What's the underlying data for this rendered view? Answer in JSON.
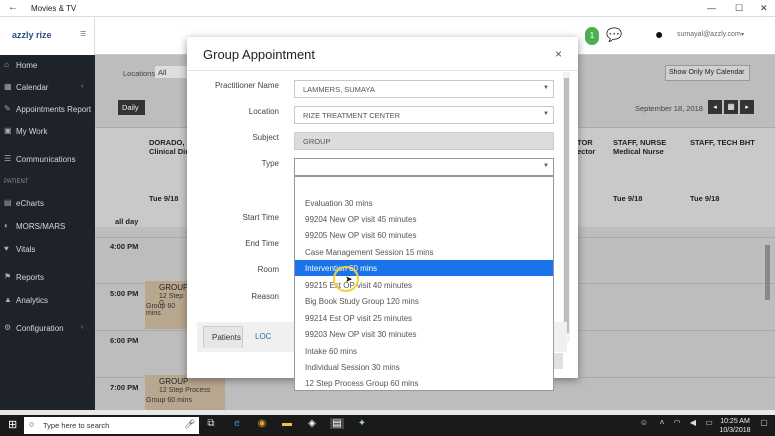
{
  "window": {
    "title": "Movies & TV",
    "minimize": "—",
    "maximize": "☐",
    "close": "✕"
  },
  "app": {
    "logo": "azzly rize",
    "notification_count": "1",
    "user_email": "sumayal@azzly.com"
  },
  "sidebar": {
    "section_patient": "PATIENT",
    "items": [
      {
        "label": "Home",
        "icon": "⌂"
      },
      {
        "label": "Calendar",
        "icon": "▦"
      },
      {
        "label": "Appointments Report",
        "icon": "✎"
      },
      {
        "label": "My Work",
        "icon": "▣"
      },
      {
        "label": "Communications",
        "icon": "☰"
      },
      {
        "label": "eCharts",
        "icon": "▤"
      },
      {
        "label": "MORS/MARS",
        "icon": "◐"
      },
      {
        "label": "Vitals",
        "icon": "♥"
      },
      {
        "label": "Reports",
        "icon": "⚑"
      },
      {
        "label": "Analytics",
        "icon": "▲"
      },
      {
        "label": "Configuration",
        "icon": "⚙"
      }
    ]
  },
  "calendar": {
    "locations_label": "Locations:",
    "locations_value": "All",
    "show_only_button": "Show Only My Calendar",
    "view_daily": "Daily",
    "date": "September 18, 2018",
    "col1_header": "DORADO, I Clinical Dir",
    "col_tor": "TOR ector",
    "col_staff_nurse": "STAFF, NURSE Medical Nurse",
    "col_staff_tech": "STAFF, TECH BHT",
    "day_label": "Tue 9/18",
    "all_day": "all day",
    "times": [
      "4:00 PM",
      "5:00 PM",
      "6:00 PM",
      "7:00 PM"
    ],
    "event1": {
      "title": "GROUP",
      "line1": "12 Step G",
      "line2": "Group 60 mins"
    },
    "event2": {
      "title": "GROUP",
      "line1": "12 Step Process",
      "line2": "Group 60 mins"
    }
  },
  "modal": {
    "title": "Group Appointment",
    "close": "×",
    "fields": {
      "practitioner_label": "Practitioner Name",
      "practitioner_value": "LAMMERS, SUMAYA",
      "location_label": "Location",
      "location_value": "RIZE TREATMENT CENTER",
      "subject_label": "Subject",
      "subject_value": "GROUP",
      "type_label": "Type",
      "type_value": "",
      "start_label": "Start Time",
      "end_label": "End Time",
      "room_label": "Room",
      "reason_label": "Reason"
    },
    "tabs": {
      "patients": "Patients",
      "loc": "LOC"
    }
  },
  "dropdown": {
    "options": [
      "Evaluation 30 mins",
      "99204 New OP visit 45 minutes",
      "99205 New OP visit 60 minutes",
      "Case Management Session 15 mins",
      "Intervention 60 mins",
      "99215 Est OP visit 40 minutes",
      "Big Book Study Group 120 mins",
      "99214 Est OP visit 25 minutes",
      "99203 New OP visit 30 minutes",
      "Intake 60 mins",
      "Individual Session 30 mins",
      "12 Step Process Group 60 mins"
    ],
    "selected_index": 4
  },
  "taskbar": {
    "search_placeholder": "Type here to search",
    "time": "10:25 AM",
    "date": "10/3/2018"
  },
  "colors": {
    "accent": "#1a73e8",
    "sidebar": "#1e2229",
    "event": "#f3dcc0"
  }
}
